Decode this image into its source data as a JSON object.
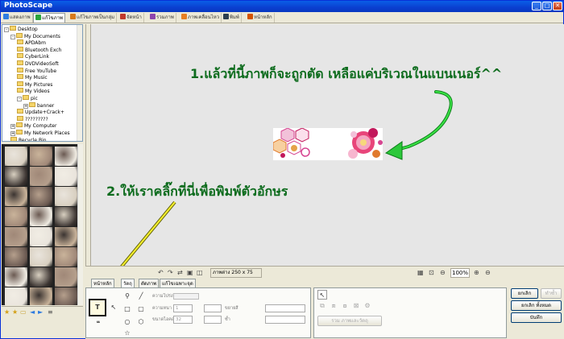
{
  "window": {
    "title": "PhotoScape",
    "min_label": "_",
    "max_label": "□",
    "close_label": "✕"
  },
  "tabs": [
    {
      "label": "แสดงภาพ",
      "color": "#2d7be0"
    },
    {
      "label": "แก้ไขภาพ",
      "color": "#2aa53c",
      "active": true
    },
    {
      "label": "แก้ไขภาพเป็นกลุ่ม",
      "color": "#d87a1a"
    },
    {
      "label": "จัดหน้า",
      "color": "#c0392b"
    },
    {
      "label": "รวมภาพ",
      "color": "#8e44ad"
    },
    {
      "label": "ภาพเคลื่อนไหว",
      "color": "#e67e22"
    },
    {
      "label": "พิมพ์",
      "color": "#2c3e50"
    },
    {
      "label": "หน้าหลัก",
      "color": "#d35400"
    }
  ],
  "tree": [
    {
      "label": "Desktop",
      "indent": 0,
      "pm": "-"
    },
    {
      "label": "My Documents",
      "indent": 1,
      "pm": "-"
    },
    {
      "label": "APDAbm",
      "indent": 2
    },
    {
      "label": "Bluetooth Exch",
      "indent": 2
    },
    {
      "label": "CyberLink",
      "indent": 2
    },
    {
      "label": "DVDVideoSoft",
      "indent": 2
    },
    {
      "label": "Free YouTube",
      "indent": 2
    },
    {
      "label": "My Music",
      "indent": 2
    },
    {
      "label": "My Pictures",
      "indent": 2
    },
    {
      "label": "My Videos",
      "indent": 2
    },
    {
      "label": "pic",
      "indent": 2,
      "pm": "-"
    },
    {
      "label": "banner",
      "indent": 3,
      "pm": "+"
    },
    {
      "label": "Update+Crack+",
      "indent": 2
    },
    {
      "label": "?????????",
      "indent": 2
    },
    {
      "label": "My Computer",
      "indent": 1,
      "pm": "+"
    },
    {
      "label": "My Network Places",
      "indent": 1,
      "pm": "+"
    },
    {
      "label": "Recycle Bin",
      "indent": 1
    }
  ],
  "annotations": {
    "step1": "1.แล้วที่นี้ภาพก็จะถูกตัด เหลือแค่บริเวณในแบนเนอร์^^",
    "step2": "2.ให้เราคลิ๊กที่นี่เพื่อพิมพ์ตัวอักษร"
  },
  "toolbar": {
    "size_label": "ภาพต่าง 250 x 75",
    "zoom": "100%"
  },
  "panel": {
    "tabs": [
      {
        "label": "หน้าหลัก"
      },
      {
        "label": "วัตถุ",
        "active": true
      },
      {
        "label": "ตัดภาพ"
      },
      {
        "label": "แก้ไขเฉพาะจุด"
      }
    ],
    "text_tool": "T",
    "quote_tool": "❝",
    "labels": {
      "l1": "ความโปร่งใส",
      "l2": "ความหนา",
      "l3": "ขนาดไอคอน",
      "l4": "ขยายสี",
      "l5": "ซ้ำ",
      "recolor": "รวม ภาพและวัตถุ"
    },
    "values": {
      "v1": "1",
      "v2": "32"
    }
  },
  "buttons": {
    "cancel": "ยกเลิก",
    "redo": "ทำซ้ำ",
    "cancel_all": "ยกเลิก ทั้งหมด",
    "save": "บันทึก"
  }
}
